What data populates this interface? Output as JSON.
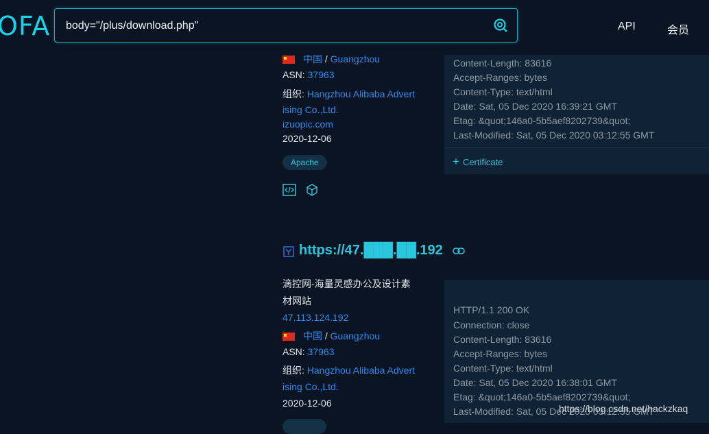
{
  "header": {
    "logo": "OFA",
    "search_value": "body=\"/plus/download.php\"",
    "nav": [
      "API",
      "会员"
    ]
  },
  "result1": {
    "location_country": "中国",
    "location_sep": " / ",
    "location_city": "Guangzhou",
    "asn_label": "ASN: ",
    "asn": "37963",
    "org_label": "组织: ",
    "org_line1": "Hangzhou Alibaba Advert",
    "org_line2": "ising Co.,Ltd.",
    "domain": "izuopic.com",
    "date": "2020-12-06",
    "tag": "Apache",
    "headers": [
      "Content-Length: 83616",
      "Accept-Ranges: bytes",
      "Content-Type: text/html",
      "Date: Sat, 05 Dec 2020 16:39:21 GMT",
      "Etag: &quot;146a0-5b5aef8202739&quot;",
      "Last-Modified: Sat, 05 Dec 2020 03:12:55 GMT"
    ],
    "certificate": "Certificate"
  },
  "result2": {
    "url": "https://47.███.██.192",
    "title_line1": "滴控网-海量灵感办公及设计素",
    "title_line2": "材网站",
    "ip": "47.113.124.192",
    "location_country": "中国",
    "location_sep": " / ",
    "location_city": "Guangzhou",
    "asn_label": "ASN: ",
    "asn": "37963",
    "org_label": "组织: ",
    "org_line1": "Hangzhou Alibaba Advert",
    "org_line2": "ising Co.,Ltd.",
    "date": "2020-12-06",
    "headers": [
      "HTTP/1.1 200 OK",
      "Connection: close",
      "Content-Length: 83616",
      "Accept-Ranges: bytes",
      "Content-Type: text/html",
      "Date: Sat, 05 Dec 2020 16:38:01 GMT",
      "Etag: &quot;146a0-5b5aef8202739&quot;",
      "Last-Modified: Sat, 05 Dec 2020 03:12:55 GMT"
    ]
  },
  "watermark": "https://blog.csdn.net/hackzkaq"
}
